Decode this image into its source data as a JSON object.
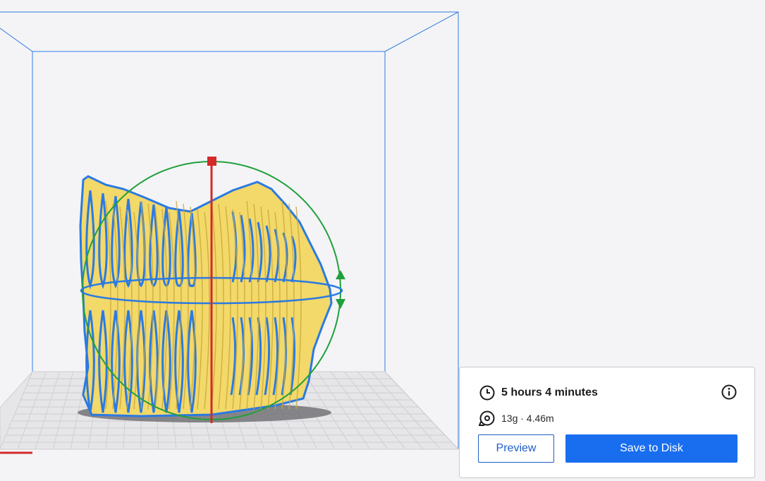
{
  "print_info": {
    "time_icon": "clock-icon",
    "time_estimate": "5 hours 4 minutes",
    "material_icon": "filament-spool-icon",
    "material_estimate": "13g · 4.46m",
    "info_icon": "info-icon"
  },
  "actions": {
    "preview_label": "Preview",
    "save_label": "Save to Disk"
  },
  "colors": {
    "accent": "#196ef0",
    "model_fill": "#f3d86a",
    "model_outline": "#2a7ae2",
    "rotate_y_handle": "#1fa03a",
    "rotate_x_handle": "#d42a2a",
    "build_volume": "#2a7ae2"
  }
}
